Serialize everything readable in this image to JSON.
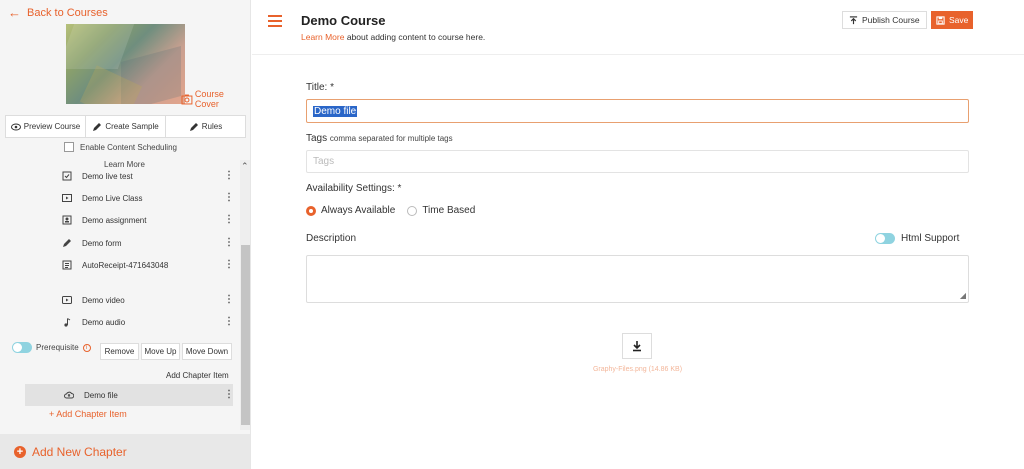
{
  "sidebar": {
    "back_label": "Back to Courses",
    "cover_label": "Course Cover",
    "actions": [
      {
        "label": "Preview Course",
        "icon": "eye-icon"
      },
      {
        "label": "Create Sample",
        "icon": "pencil-icon"
      },
      {
        "label": "Rules",
        "icon": "pencil-icon"
      }
    ],
    "scheduling_label": "Enable Content Scheduling",
    "learn_more": "Learn More",
    "items": [
      {
        "label": "Demo live test",
        "icon": "checklist-icon"
      },
      {
        "label": "Demo Live Class",
        "icon": "video-class-icon"
      },
      {
        "label": "Demo assignment",
        "icon": "assignment-icon"
      },
      {
        "label": "Demo form",
        "icon": "pencil-icon"
      },
      {
        "label": "AutoReceipt-471643048",
        "icon": "receipt-icon"
      },
      {
        "label": "Demo video",
        "icon": "play-video-icon"
      },
      {
        "label": "Demo audio",
        "icon": "music-note-icon"
      }
    ],
    "prerequisite_label": "Prerequisite",
    "remove_label": "Remove",
    "move_up_label": "Move Up",
    "move_down_label": "Move Down",
    "add_chapter_item_label": "Add Chapter Item",
    "selected_item": {
      "label": "Demo file",
      "icon": "cloud-upload-icon"
    },
    "add_chapter_item_link": "+ Add Chapter Item",
    "add_new_chapter_label": "Add New Chapter"
  },
  "header": {
    "title": "Demo Course",
    "learn_more_link": "Learn More",
    "subtitle_rest": " about adding content to course here.",
    "publish_label": "Publish Course",
    "save_label": "Save"
  },
  "form": {
    "title_label": "Title: *",
    "title_value": "Demo file",
    "tags_label": "Tags",
    "tags_hint": "comma separated for multiple tags",
    "tags_placeholder": "Tags",
    "availability_label": "Availability Settings: *",
    "availability_options": [
      {
        "label": "Always Available",
        "selected": true
      },
      {
        "label": "Time Based",
        "selected": false
      }
    ],
    "description_label": "Description",
    "html_support_label": "Html Support",
    "file_name": "Graphy-Files.png (14.86 KB)"
  },
  "colors": {
    "accent": "#e8622c",
    "toggle": "#8fd3e0"
  }
}
